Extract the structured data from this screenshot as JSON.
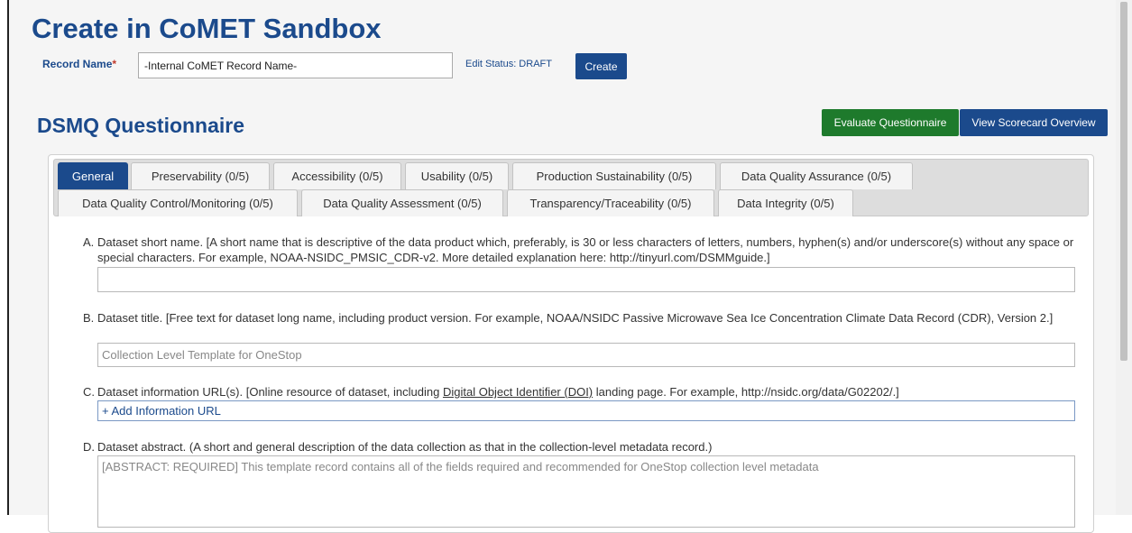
{
  "page": {
    "title": "Create in CoMET Sandbox",
    "record_name_label": "Record Name",
    "record_name_required_mark": "*",
    "record_name_value": "-Internal CoMET Record Name-",
    "edit_status": "Edit Status: DRAFT",
    "create_label": "Create"
  },
  "questionnaire": {
    "title": "DSMQ Questionnaire",
    "evaluate_label": "Evaluate Questionnaire",
    "view_scorecard_label": "View Scorecard Overview",
    "tabs_row1": [
      {
        "label": "General",
        "active": true
      },
      {
        "label": "Preservability (0/5)"
      },
      {
        "label": "Accessibility (0/5)"
      },
      {
        "label": "Usability (0/5)"
      },
      {
        "label": "Production Sustainability (0/5)"
      },
      {
        "label": "Data Quality Assurance (0/5)"
      }
    ],
    "tabs_row2": [
      {
        "label": "Data Quality Control/Monitoring (0/5)"
      },
      {
        "label": "Data Quality Assessment (0/5)"
      },
      {
        "label": "Transparency/Traceability (0/5)"
      },
      {
        "label": "Data Integrity (0/5)"
      }
    ],
    "questions": {
      "a": {
        "letter": "A.",
        "text": "Dataset short name. [A short name that is descriptive of the data product which, preferably, is 30 or less characters of letters, numbers, hyphen(s) and/or underscore(s) without any space or special characters. For example, NOAA-NSIDC_PMSIC_CDR-v2. More detailed explanation here: http://tinyurl.com/DSMMguide.]",
        "value": ""
      },
      "b": {
        "letter": "B.",
        "text": "Dataset title. [Free text for dataset long name, including product version. For example, NOAA/NSIDC Passive Microwave Sea Ice Concentration Climate Data Record (CDR), Version 2.]",
        "value": "Collection Level Template for OneStop"
      },
      "c": {
        "letter": "C.",
        "text_before": "Dataset information URL(s). [Online resource of dataset, including ",
        "link_text": "Digital Object Identifier (DOI)",
        "text_after": " landing page. For example, http://nsidc.org/data/G02202/.]",
        "add_label": "+ Add Information URL"
      },
      "d": {
        "letter": "D.",
        "text": "Dataset abstract. (A short and general description of the data collection as that in the collection-level metadata record.)",
        "value": "[ABSTRACT: REQUIRED] This template record contains all of the fields required and recommended for OneStop collection level metadata"
      }
    }
  }
}
